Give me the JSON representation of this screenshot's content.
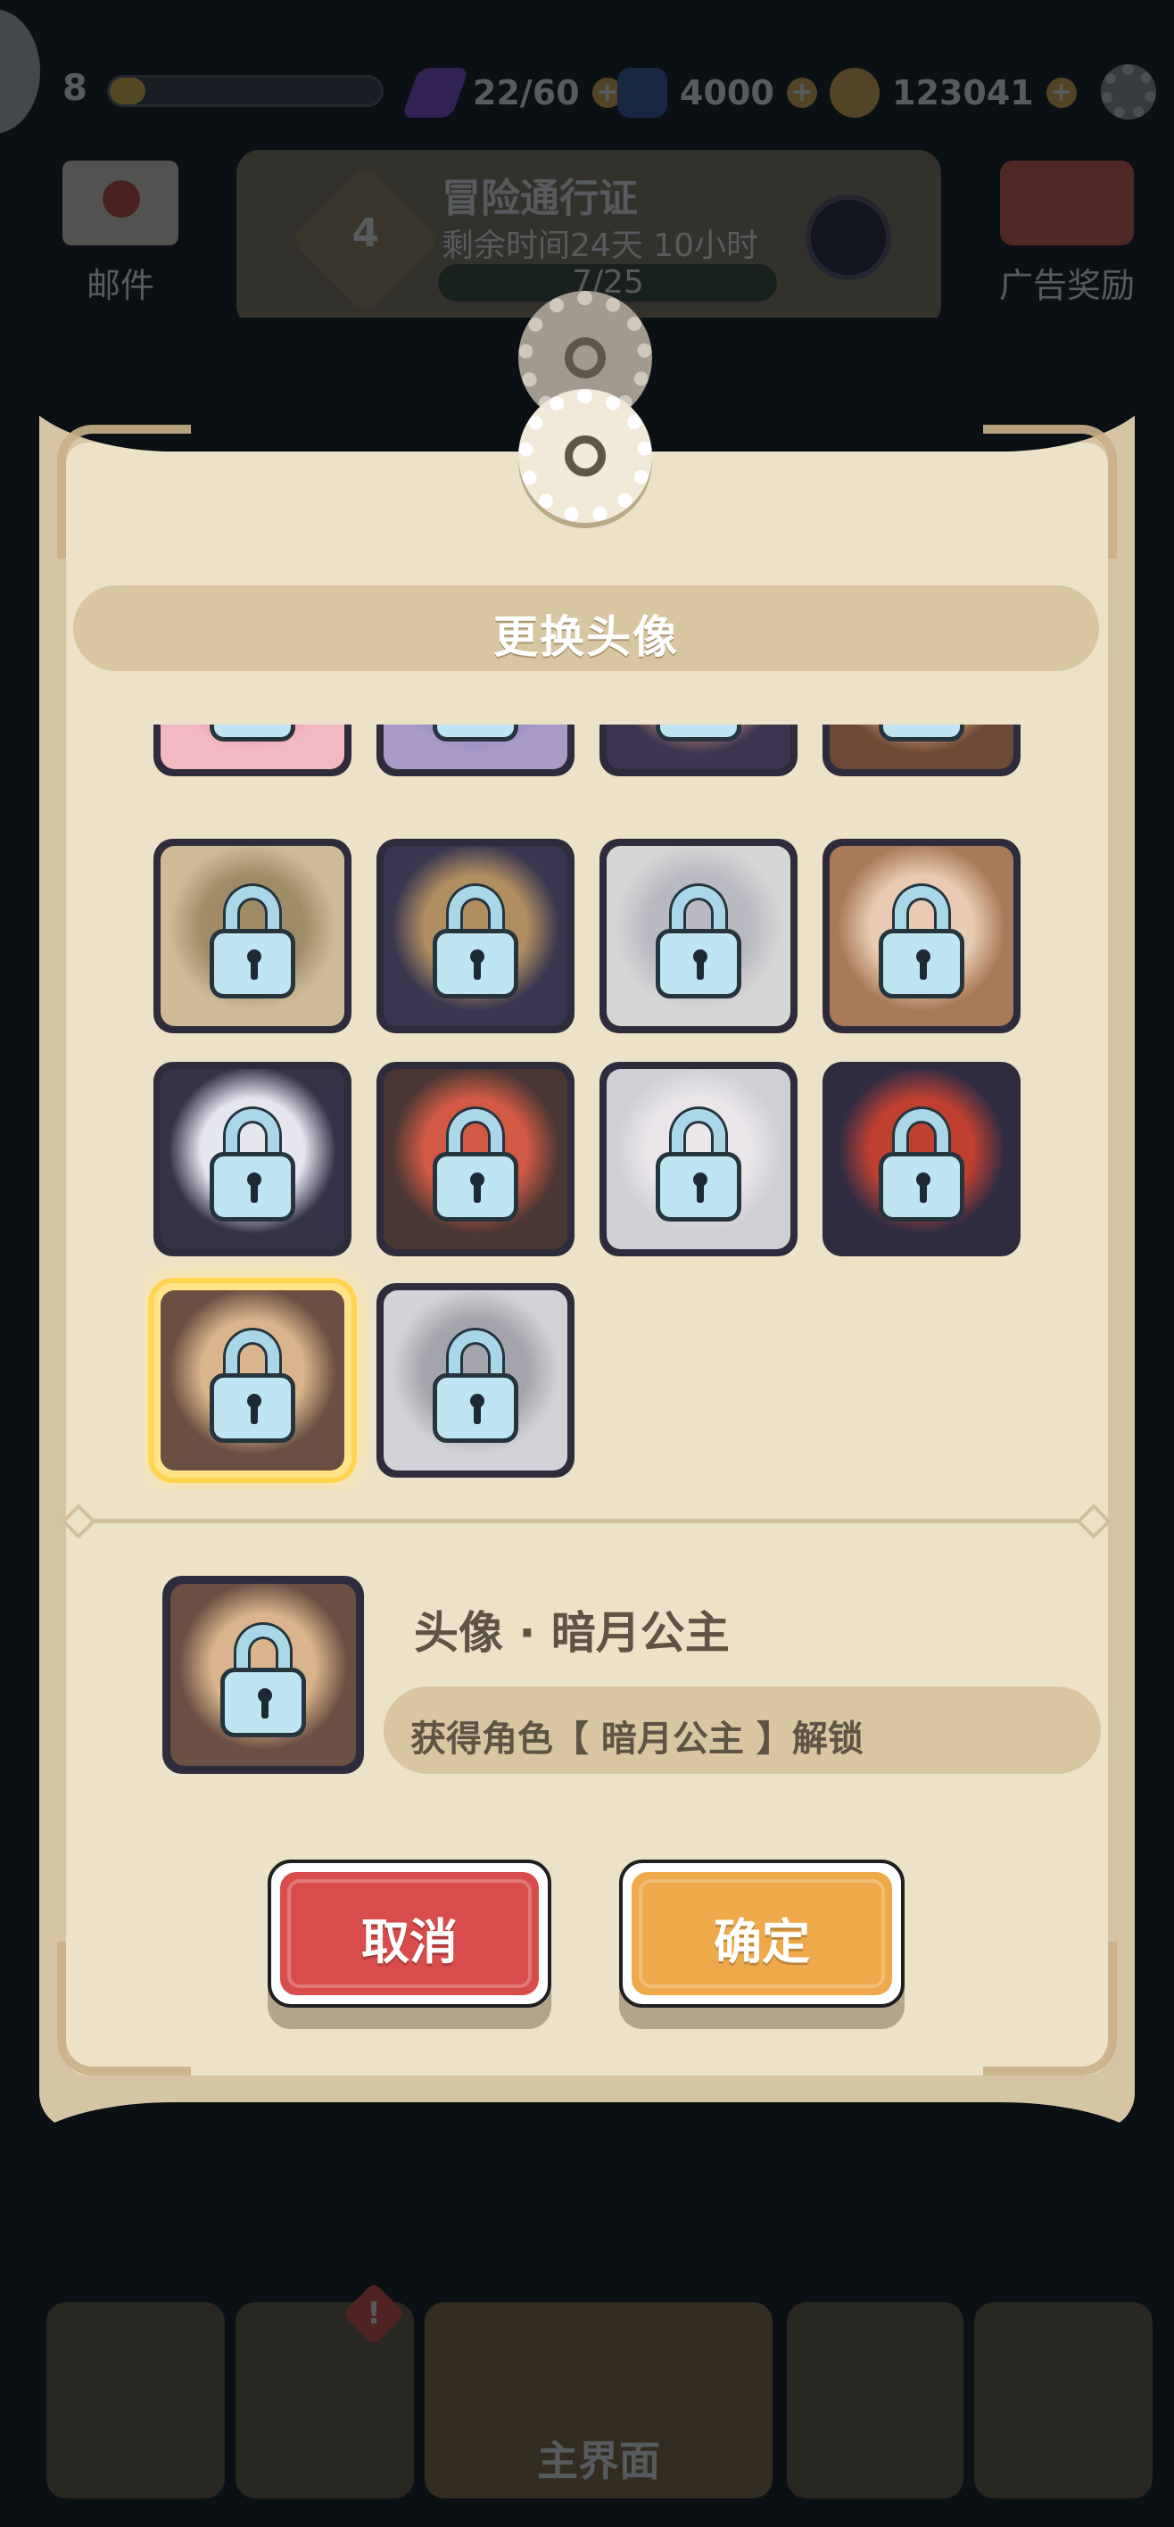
{
  "hud": {
    "level": "8",
    "energy": "22/60",
    "gems": "4000",
    "gold": "123041",
    "colors": {
      "energy": "#8b4de0",
      "gem": "#3a5fa8",
      "gold": "#f2b84b"
    }
  },
  "menu": {
    "mail_label": "邮件",
    "ad_label": "广告奖励"
  },
  "pass": {
    "title": "冒险通行证",
    "level": "4",
    "timer": "剩余时间24天 10小时",
    "progress": "7/25"
  },
  "dialog": {
    "title": "更换头像",
    "avatars": [
      {
        "id": "a1",
        "locked": true,
        "selected": false,
        "palette": [
          "#f2b9c0",
          "#ee9fb0"
        ]
      },
      {
        "id": "a2",
        "locked": true,
        "selected": false,
        "palette": [
          "#a99ac8",
          "#8c7fb8"
        ]
      },
      {
        "id": "a3",
        "locked": true,
        "selected": false,
        "palette": [
          "#3d3550",
          "#c98f7a"
        ]
      },
      {
        "id": "a4",
        "locked": true,
        "selected": false,
        "palette": [
          "#6c4a35",
          "#e0a27a"
        ]
      },
      {
        "id": "a5",
        "locked": true,
        "selected": false,
        "palette": [
          "#cdbb97",
          "#a08b67"
        ]
      },
      {
        "id": "a6",
        "locked": true,
        "selected": false,
        "palette": [
          "#3a3650",
          "#b08e60"
        ]
      },
      {
        "id": "a7",
        "locked": true,
        "selected": false,
        "palette": [
          "#d6d6d6",
          "#b9b9c2"
        ]
      },
      {
        "id": "a8",
        "locked": true,
        "selected": false,
        "palette": [
          "#a97a58",
          "#e8cbb2"
        ]
      },
      {
        "id": "a9",
        "locked": true,
        "selected": false,
        "palette": [
          "#35334a",
          "#e6e6ef"
        ]
      },
      {
        "id": "a10",
        "locked": true,
        "selected": false,
        "palette": [
          "#4a3733",
          "#d25a45"
        ]
      },
      {
        "id": "a11",
        "locked": true,
        "selected": false,
        "palette": [
          "#cfcfd6",
          "#eae6ea"
        ]
      },
      {
        "id": "a12",
        "locked": true,
        "selected": false,
        "palette": [
          "#2f2c44",
          "#c04030"
        ]
      },
      {
        "id": "a13",
        "locked": true,
        "selected": true,
        "palette": [
          "#6a4f42",
          "#d9b48c"
        ]
      },
      {
        "id": "a14",
        "locked": true,
        "selected": false,
        "palette": [
          "#d2d2d8",
          "#a4a4ac"
        ]
      }
    ],
    "detail": {
      "name": "头像 · 暗月公主",
      "unlock_condition": "获得角色【 暗月公主 】解锁"
    },
    "cancel_label": "取消",
    "confirm_label": "确定"
  },
  "bottom_nav": {
    "main_label": "主界面",
    "badge": "!"
  }
}
